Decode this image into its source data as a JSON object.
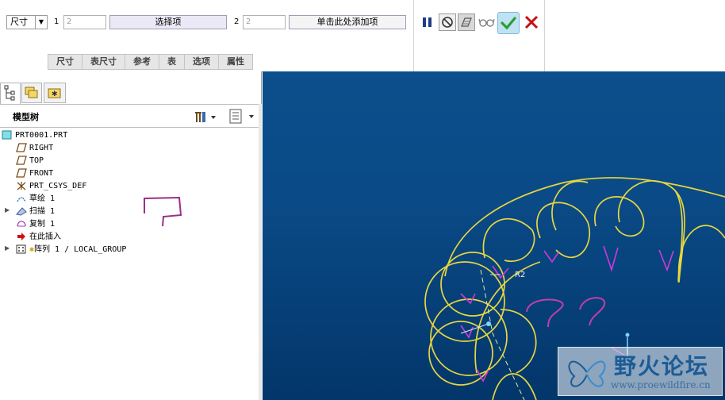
{
  "dashboard": {
    "type_select": "尺寸",
    "ref1_index": "1",
    "ref1_value": "2",
    "ref1_collector": "选择项",
    "ref2_index": "2",
    "ref2_value": "2",
    "ref2_collector": "单击此处添加项",
    "tabs": [
      "尺寸",
      "表尺寸",
      "参考",
      "表",
      "选项",
      "属性"
    ],
    "colors": {
      "apply": "#2e9e2e",
      "cancel": "#c41010",
      "collector_active": "#ece9f6"
    }
  },
  "navigator": {
    "title": "模型树",
    "items": [
      {
        "label": "PRT0001.PRT",
        "icon": "part-icon"
      },
      {
        "label": "RIGHT",
        "icon": "datum-plane-icon"
      },
      {
        "label": "TOP",
        "icon": "datum-plane-icon"
      },
      {
        "label": "FRONT",
        "icon": "datum-plane-icon"
      },
      {
        "label": "PRT_CSYS_DEF",
        "icon": "csys-icon"
      },
      {
        "label": "草绘 1",
        "icon": "sketch-icon"
      },
      {
        "label": "扫描 1",
        "icon": "sweep-icon"
      },
      {
        "label": "复制 1",
        "icon": "copy-icon"
      },
      {
        "label": "在此插入",
        "icon": "insert-here-arrow-icon"
      },
      {
        "label": "阵列 1 / LOCAL_GROUP",
        "icon": "pattern-icon"
      }
    ]
  },
  "viewport": {
    "dimension_label": "R2",
    "annotation": "? ?"
  },
  "watermark": {
    "title": "野火论坛",
    "url": "www.proewildfire.cn"
  }
}
